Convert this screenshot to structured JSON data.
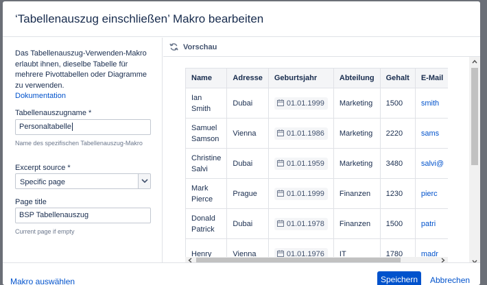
{
  "dialog": {
    "title": "‘Tabellenauszug einschließen’ Makro bearbeiten"
  },
  "left_panel": {
    "description": "Das Tabellenauszug-Verwenden-Makro erlaubt ihnen, dieselbe Tabelle für mehrere Pivottabellen oder Diagramme zu verwenden.",
    "doc_link": "Dokumentation",
    "name_label": "Tabellenauszugname *",
    "name_value": "Personaltabelle",
    "name_help": "Name des spezifischen Tabellenauszug-Makro",
    "excerpt_source_label": "Excerpt source *",
    "excerpt_source_value": "Specific page",
    "page_title_label": "Page title",
    "page_title_value": "BSP Tabellenauszug",
    "page_title_help": "Current page if empty"
  },
  "preview": {
    "label": "Vorschau",
    "icon": "refresh-icon",
    "columns": [
      "Name",
      "Adresse",
      "Geburtsjahr",
      "Abteilung",
      "Gehalt",
      "E-Mail"
    ],
    "rows": [
      {
        "name": "Ian Smith",
        "address": "Dubai",
        "birth": "01.01.1999",
        "department": "Marketing",
        "salary": "1500",
        "email": "smith"
      },
      {
        "name": "Samuel Samson",
        "address": "Vienna",
        "birth": "01.01.1986",
        "department": "Marketing",
        "salary": "2220",
        "email": "sams"
      },
      {
        "name": "Christine Salvi",
        "address": "Dubai",
        "birth": "01.01.1959",
        "department": "Marketing",
        "salary": "3480",
        "email": "salvi@"
      },
      {
        "name": "Mark Pierce",
        "address": "Prague",
        "birth": "01.01.1999",
        "department": "Finanzen",
        "salary": "1230",
        "email": "pierc"
      },
      {
        "name": "Donald Patrick",
        "address": "Dubai",
        "birth": "01.01.1978",
        "department": "Finanzen",
        "salary": "1500",
        "email": "patri"
      },
      {
        "name": "Henry",
        "address": "Vienna",
        "birth": "01.01.1976",
        "department": "IT",
        "salary": "1780",
        "email": "madr"
      }
    ]
  },
  "footer": {
    "select_macro": "Makro auswählen",
    "save": "Speichern",
    "cancel": "Abbrechen"
  },
  "colors": {
    "accent": "#0052cc",
    "text": "#172b4d",
    "border": "#dfe1e6",
    "overlay": "#6b6f77"
  }
}
